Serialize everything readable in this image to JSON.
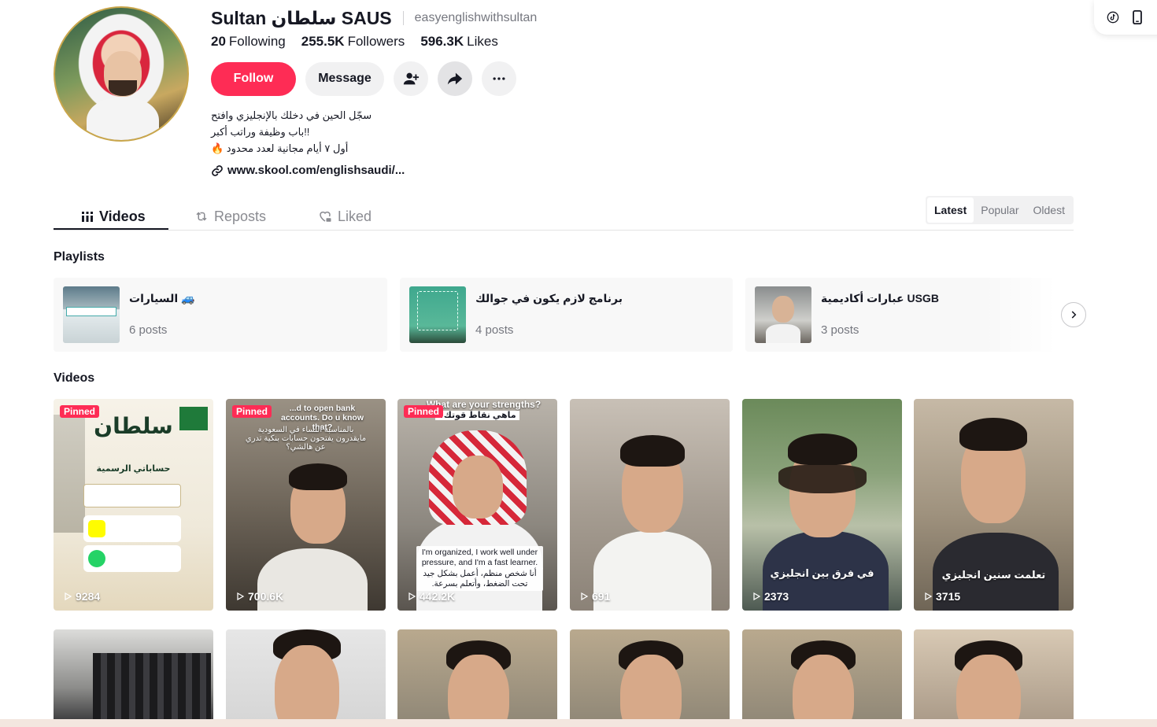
{
  "profile": {
    "display_name": "Sultan سلطان SAUS",
    "username": "easyenglishwithsultan",
    "stats": {
      "following_count": "20",
      "following_label": "Following",
      "followers_count": "255.5K",
      "followers_label": "Followers",
      "likes_count": "596.3K",
      "likes_label": "Likes"
    },
    "follow_label": "Follow",
    "message_label": "Message",
    "bio_lines": [
      "سجّل الحين في دخلك بالإنجليزي وافتح",
      "!!باب وظيفة وراتب أكبر",
      "أول ٧ أيام مجانية لعدد محدود 🔥"
    ],
    "link": "www.skool.com/englishsaudi/..."
  },
  "tabs": {
    "videos": "Videos",
    "reposts": "Reposts",
    "liked": "Liked"
  },
  "sort": {
    "latest": "Latest",
    "popular": "Popular",
    "oldest": "Oldest"
  },
  "sections": {
    "playlists": "Playlists",
    "videos": "Videos"
  },
  "playlists": [
    {
      "title": "السيارات 🚙",
      "posts": "6 posts"
    },
    {
      "title": "برنامج لازم يكون في جوالك",
      "posts": "4 posts"
    },
    {
      "title": "عبارات أكاديمية USGB",
      "posts": "3 posts"
    }
  ],
  "videos": [
    {
      "pinned": "Pinned",
      "views": "9284",
      "overlay_title": "سلطان",
      "overlay_sub": "حساباتي الرسمية"
    },
    {
      "pinned": "Pinned",
      "views": "700.6K",
      "caption_en": "...d to open bank accounts. Do u know that?",
      "caption_ar": "بالمناسبة النساء في السعودية مايقدرون يفتحون حسابات بنكية تدري عن هالشي؟"
    },
    {
      "pinned": "Pinned",
      "views": "442.2K",
      "caption_en": "What are your strengths?",
      "caption_ar": "ماهي نقاط قوتك؟",
      "subtitle_en": "I'm organized, I work well under pressure, and I'm a fast learner.",
      "subtitle_ar": "أنا شخص منظم، أعمل بشكل جيد تحت الضغط، وأتعلم بسرعة."
    },
    {
      "views": "691"
    },
    {
      "views": "2373",
      "caption_ar": "في فرق بين انجليزي"
    },
    {
      "views": "3715",
      "caption_ar": "تعلمت سنين انجليزي"
    }
  ],
  "colors": {
    "accent": "#fe2c55",
    "text": "#161823",
    "muted": "#75777f"
  }
}
